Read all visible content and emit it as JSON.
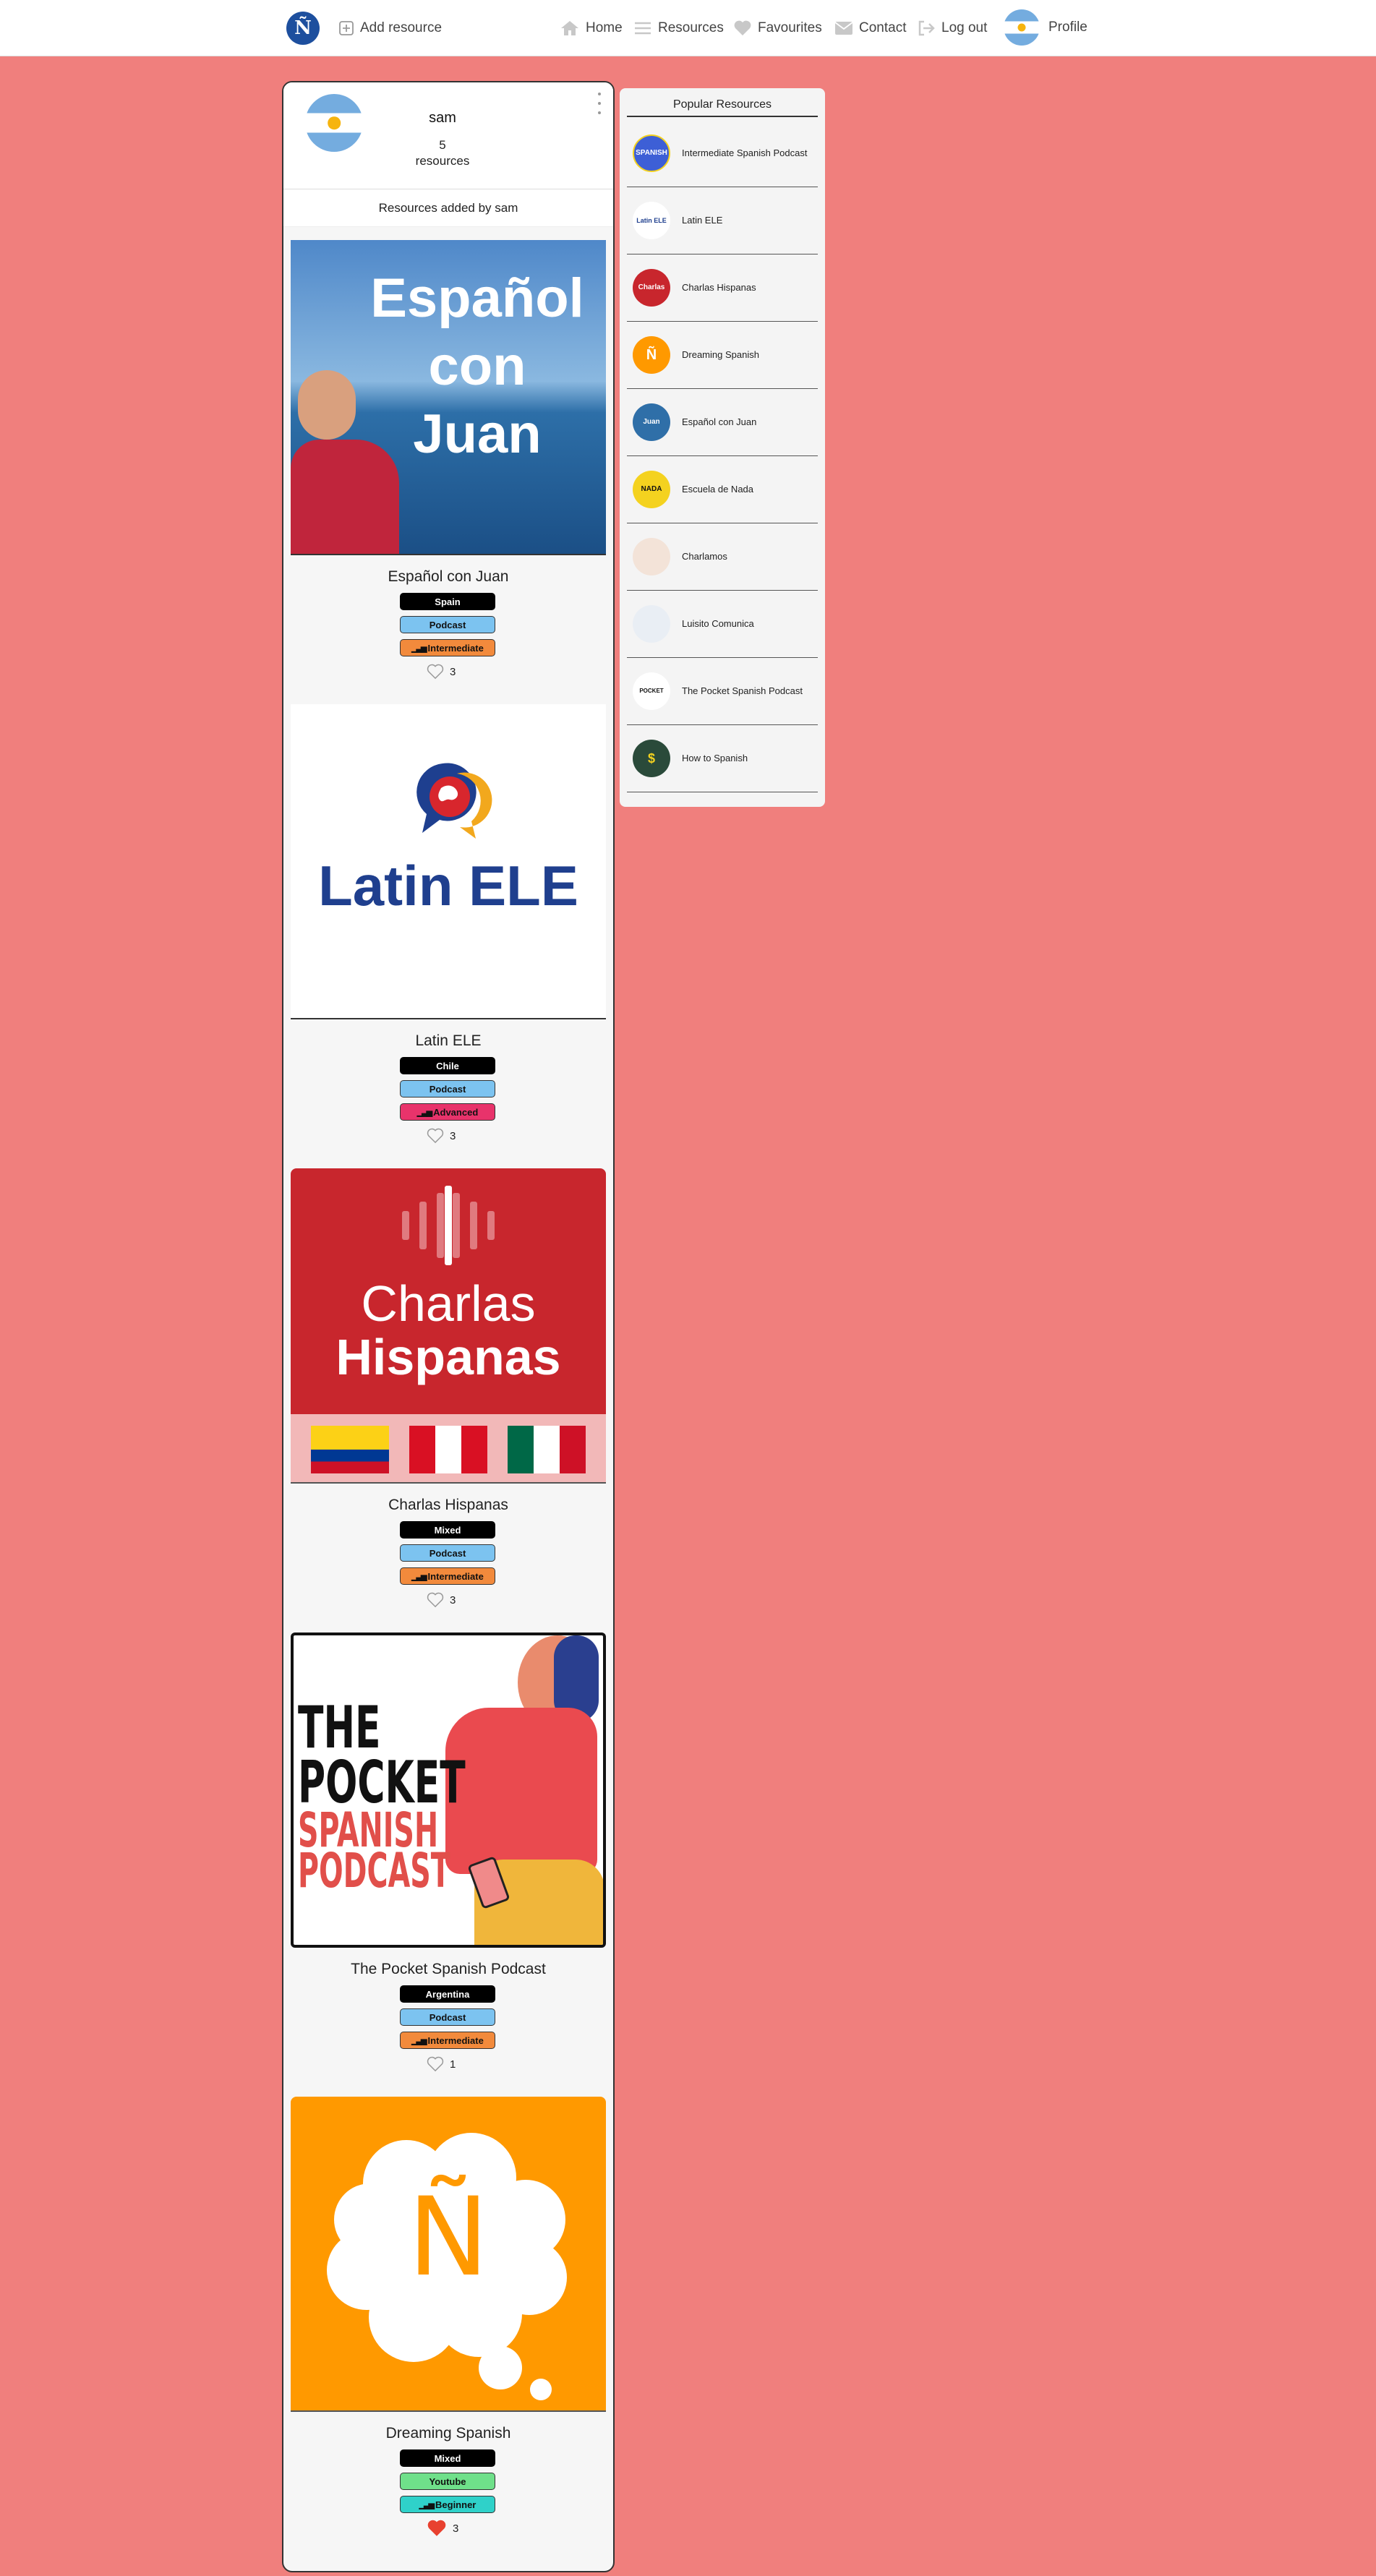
{
  "nav": {
    "logo_glyph": "Ñ",
    "add_resource": "Add resource",
    "home": "Home",
    "resources": "Resources",
    "favourites": "Favourites",
    "contact": "Contact",
    "logout": "Log out",
    "profile": "Profile"
  },
  "profile": {
    "username": "sam",
    "count_number": "5",
    "count_label": "resources",
    "section_title": "Resources added by sam"
  },
  "resources": [
    {
      "title": "Español con Juan",
      "country": "Spain",
      "type": "Podcast",
      "level": "Intermediate",
      "likes": "3",
      "liked": false,
      "image_text": [
        "Español",
        "con",
        "Juan"
      ]
    },
    {
      "title": "Latin ELE",
      "country": "Chile",
      "type": "Podcast",
      "level": "Advanced",
      "likes": "3",
      "liked": false,
      "image_text": [
        "Latin ELE"
      ]
    },
    {
      "title": "Charlas Hispanas",
      "country": "Mixed",
      "type": "Podcast",
      "level": "Intermediate",
      "likes": "3",
      "liked": false,
      "image_text": [
        "Charlas",
        "Hispanas"
      ]
    },
    {
      "title": "The Pocket Spanish Podcast",
      "country": "Argentina",
      "type": "Podcast",
      "level": "Intermediate",
      "likes": "1",
      "liked": false,
      "image_text": [
        "THE",
        "POCKET",
        "SPANISH",
        "PODCAST"
      ]
    },
    {
      "title": "Dreaming Spanish",
      "country": "Mixed",
      "type": "Youtube",
      "level": "Beginner",
      "likes": "3",
      "liked": true,
      "image_text": [
        "Ñ"
      ]
    }
  ],
  "popular": {
    "title": "Popular Resources",
    "items": [
      {
        "name": "Intermediate Spanish Podcast",
        "thumb_color": "#3d5fd6",
        "thumb_text": "SPANISH"
      },
      {
        "name": "Latin ELE",
        "thumb_color": "#ffffff",
        "thumb_text": "Latin ELE"
      },
      {
        "name": "Charlas Hispanas",
        "thumb_color": "#c8262d",
        "thumb_text": "Charlas"
      },
      {
        "name": "Dreaming Spanish",
        "thumb_color": "#ff9900",
        "thumb_text": "Ñ"
      },
      {
        "name": "Español con Juan",
        "thumb_color": "#2f6fa8",
        "thumb_text": "Juan"
      },
      {
        "name": "Escuela de Nada",
        "thumb_color": "#f4d21f",
        "thumb_text": "NADA"
      },
      {
        "name": "Charlamos",
        "thumb_color": "#f3e3d8",
        "thumb_text": ""
      },
      {
        "name": "Luisito Comunica",
        "thumb_color": "#e9eef4",
        "thumb_text": ""
      },
      {
        "name": "The Pocket Spanish Podcast",
        "thumb_color": "#ffffff",
        "thumb_text": "POCKET"
      },
      {
        "name": "How to Spanish",
        "thumb_color": "#2a4a3a",
        "thumb_text": "$"
      }
    ]
  },
  "colors": {
    "background": "#f07f7d",
    "intermediate": "#f28a3c",
    "advanced": "#e8336b",
    "beginner": "#2fd1c9",
    "podcast": "#7cc3f0",
    "youtube": "#6fe08a"
  }
}
